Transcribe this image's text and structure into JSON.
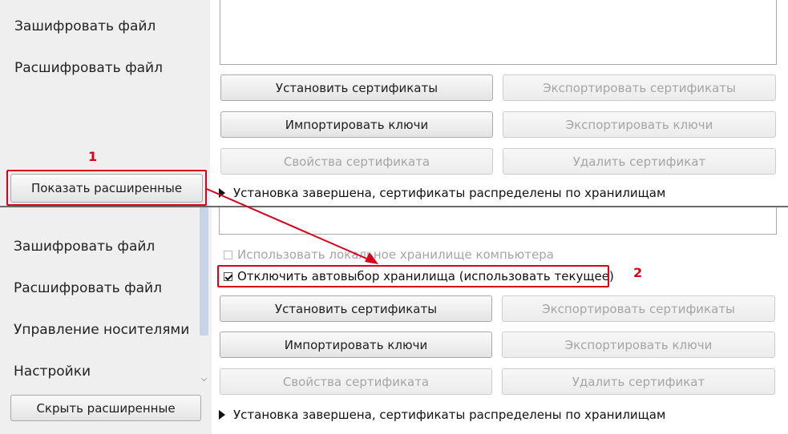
{
  "top_panel": {
    "sidebar": {
      "items": [
        "Зашифровать файл",
        "Расшифровать файл"
      ],
      "toggle_button": "Показать расширенные"
    },
    "buttons": {
      "install_certs": "Установить сертификаты",
      "export_certs": "Экспортировать сертификаты",
      "import_keys": "Импортировать ключи",
      "export_keys": "Экспортировать ключи",
      "cert_props": "Свойства сертификата",
      "delete_cert": "Удалить сертификат"
    },
    "status": "Установка завершена, сертификаты распределены по хранилищам"
  },
  "bottom_panel": {
    "sidebar": {
      "items": [
        "Зашифровать файл",
        "Расшифровать файл",
        "Управление носителями",
        "Настройки"
      ],
      "toggle_button": "Скрыть расширенные"
    },
    "checkboxes": {
      "use_local_store": {
        "label": "Использовать локальное хранилище компьютера",
        "checked": false,
        "enabled": false
      },
      "disable_autoselect": {
        "label": "Отключить автовыбор хранилища (использовать текущее)",
        "checked": true,
        "enabled": true
      }
    },
    "buttons": {
      "install_certs": "Установить сертификаты",
      "export_certs": "Экспортировать сертификаты",
      "import_keys": "Импортировать ключи",
      "export_keys": "Экспортировать ключи",
      "cert_props": "Свойства сертификата",
      "delete_cert": "Удалить сертификат"
    },
    "status": "Установка завершена, сертификаты распределены по хранилищам"
  },
  "annotations": {
    "marker_1": "1",
    "marker_2": "2",
    "color": "#d9001b"
  }
}
